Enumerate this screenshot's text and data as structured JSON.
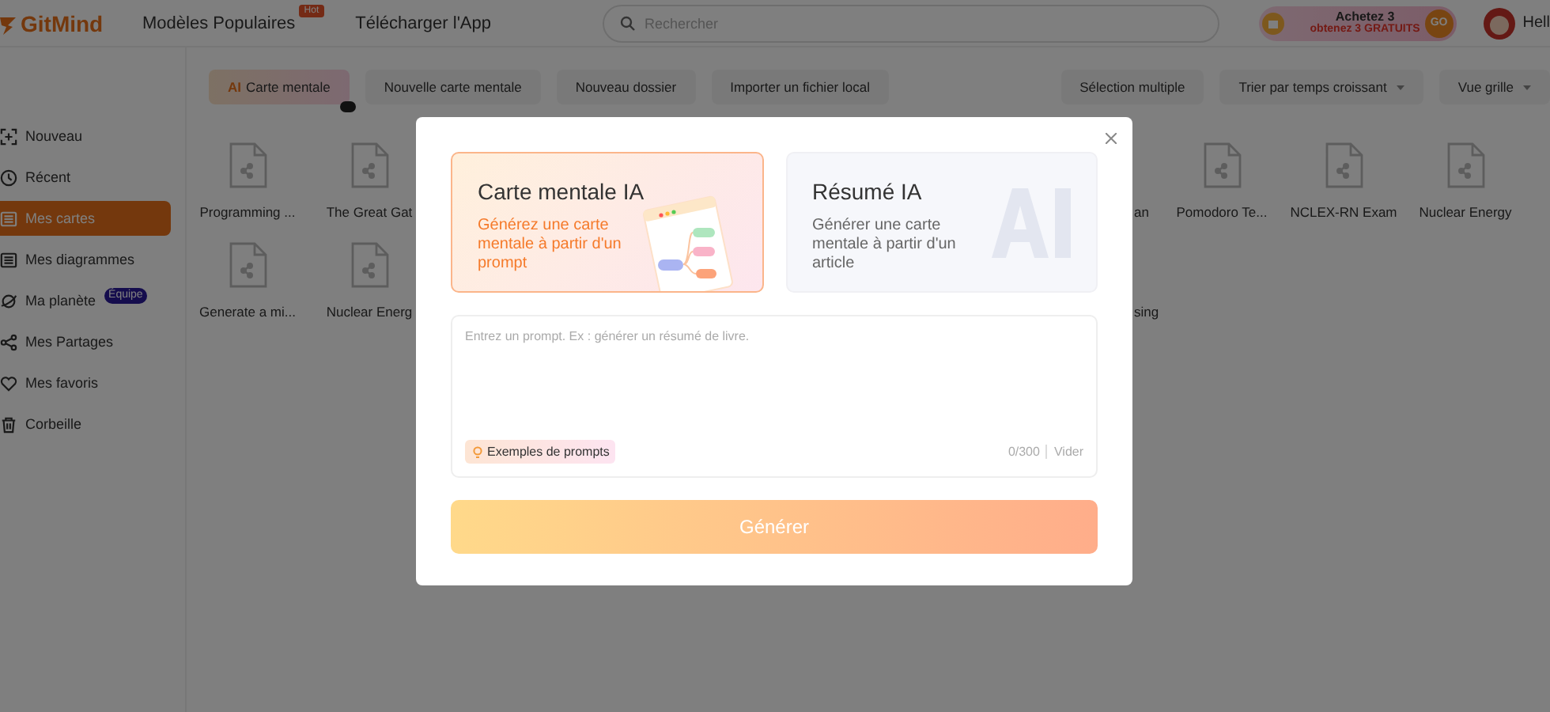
{
  "header": {
    "logo": "GitMind",
    "nav": [
      {
        "label": "Modèles Populaires",
        "badge": "Hot"
      },
      {
        "label": "Télécharger l'App"
      }
    ],
    "search": {
      "placeholder": "Rechercher"
    },
    "promo": {
      "line_1": "Achetez 3",
      "line_2": "obtenez 3 GRATUITS",
      "button": "GO"
    },
    "user": "Hell"
  },
  "sidebar": {
    "items": [
      {
        "label": "Nouveau",
        "selected": false
      },
      {
        "label": "Récent",
        "selected": false
      },
      {
        "label": "Mes cartes",
        "selected": true
      },
      {
        "label": "Mes diagrammes",
        "selected": false
      },
      {
        "label": "Ma planète",
        "selected": false,
        "badge": "Équipe"
      },
      {
        "label": "Mes Partages",
        "selected": false
      },
      {
        "label": "Mes favoris",
        "selected": false
      },
      {
        "label": "Corbeille",
        "selected": false
      }
    ]
  },
  "toolbar": {
    "left": [
      {
        "label": "Carte mentale",
        "prefix": "AI",
        "kind": "ai"
      },
      {
        "label": "Nouvelle carte mentale",
        "kind": "plain"
      },
      {
        "label": "Nouveau dossier",
        "kind": "plain"
      },
      {
        "label": "Importer un fichier local",
        "kind": "plain"
      }
    ],
    "right": [
      {
        "label": "Sélection multiple",
        "dropdown": false
      },
      {
        "label": "Trier par temps croissant",
        "dropdown": true
      },
      {
        "label": "Vue grille",
        "dropdown": true
      }
    ]
  },
  "files": {
    "rows": [
      {
        "left": [
          "Programming ...",
          "The Great Gat"
        ],
        "right": [
          "an",
          "Pomodoro Te...",
          "NCLEX-RN Exam",
          "Nuclear Energy"
        ]
      },
      {
        "left": [
          "Generate a mi...",
          "Nuclear Energ"
        ],
        "right": [
          "sing"
        ]
      }
    ]
  },
  "dialog": {
    "options": [
      {
        "title": "Carte mentale IA",
        "description": "Générez une carte mentale à partir d'un prompt",
        "selected": true
      },
      {
        "title": "Résumé IA",
        "description": "Générer une carte mentale à partir d'un article",
        "selected": false
      }
    ],
    "prompt": {
      "placeholder": "Entrez un prompt. Ex : générer un résumé de livre.",
      "examples": "Exemples de prompts",
      "counter": "0/300",
      "clear": "Vider"
    },
    "submit": "Générer"
  }
}
